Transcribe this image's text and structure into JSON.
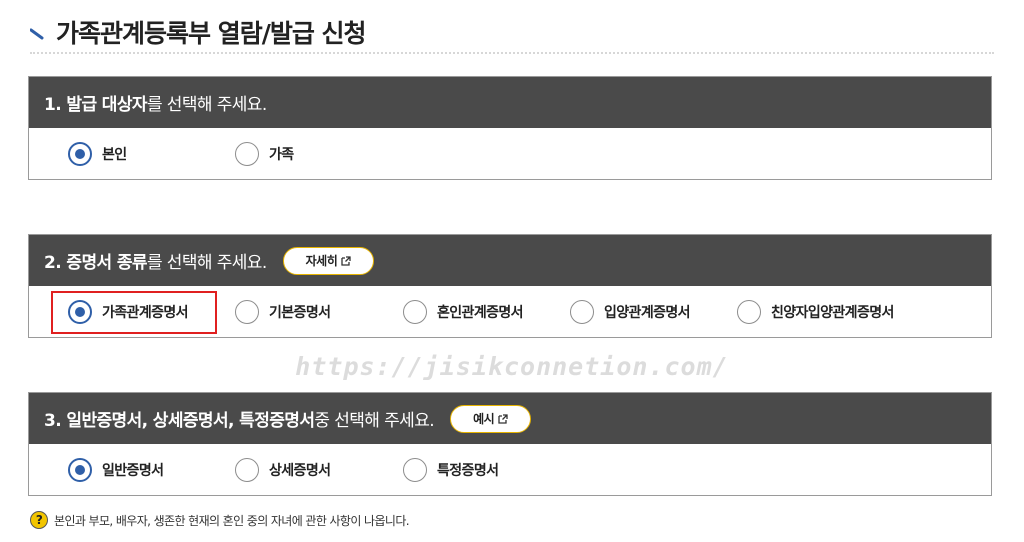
{
  "page": {
    "title": "가족관계등록부 열람/발급 신청"
  },
  "sections": [
    {
      "number_bold": "1. 발급 대상자",
      "rest": "를 선택해 주세요.",
      "options": [
        {
          "label": "본인",
          "checked": true
        },
        {
          "label": "가족",
          "checked": false
        }
      ]
    },
    {
      "number_bold": "2. 증명서 종류",
      "rest": "를 선택해 주세요.",
      "button_label": "자세히",
      "options": [
        {
          "label": "가족관계증명서",
          "checked": true
        },
        {
          "label": "기본증명서",
          "checked": false
        },
        {
          "label": "혼인관계증명서",
          "checked": false
        },
        {
          "label": "입양관계증명서",
          "checked": false
        },
        {
          "label": "친양자입양관계증명서",
          "checked": false
        }
      ]
    },
    {
      "number_bold": "3. 일반증명서, 상세증명서, 특정증명서",
      "rest": " 중 선택해 주세요.",
      "button_label": "예시",
      "options": [
        {
          "label": "일반증명서",
          "checked": true
        },
        {
          "label": "상세증명서",
          "checked": false
        },
        {
          "label": "특정증명서",
          "checked": false
        }
      ]
    }
  ],
  "watermark": "https://jisikconnetion.com/",
  "note": {
    "icon": "help-icon",
    "icon_glyph": "?",
    "text": "본인과 부모, 배우자, 생존한 현재의 혼인 중의 자녀에 관한 사항이 나옵니다."
  },
  "colors": {
    "header_bg": "#4a4a4a",
    "radio_selected": "#2f5fa8",
    "button_border": "#e7b400",
    "highlight": "#e02020",
    "help_icon": "#f2c500"
  }
}
